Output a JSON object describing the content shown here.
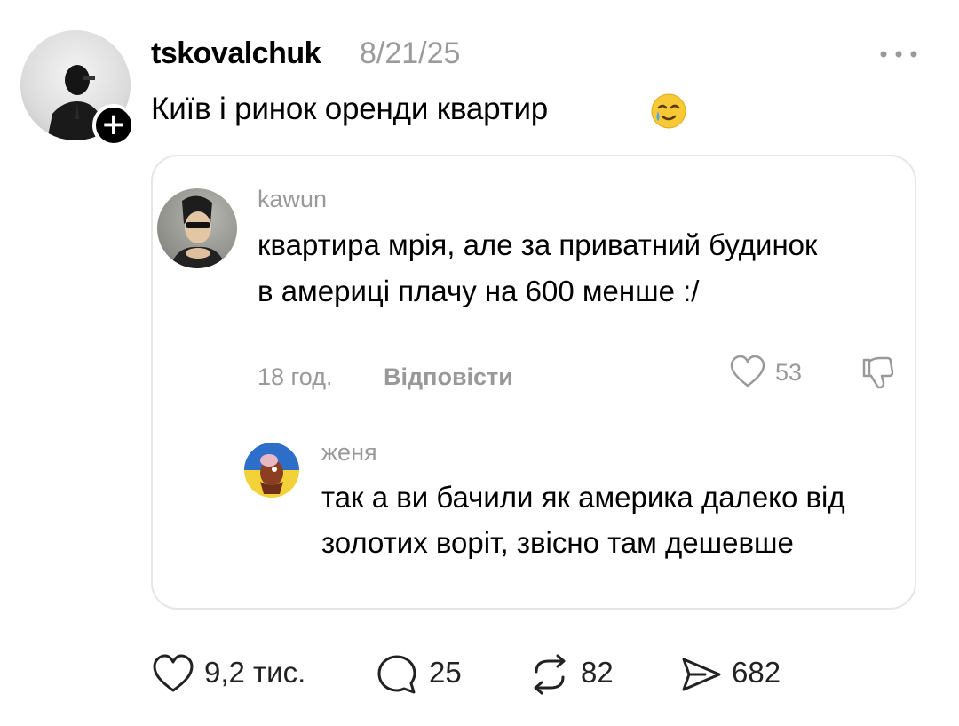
{
  "post": {
    "username": "tskovalchuk",
    "date": "8/21/25",
    "text": "Київ і ринок оренди квартир",
    "follow_symbol": "+",
    "more_icon": "more-horizontal-icon",
    "emoji_icon": "smiling-face-with-tear-icon"
  },
  "quoted_comment": {
    "author": "kawun",
    "text": "квартира мрія, але за приватний будинок в америці плачу на 600 менше :/",
    "time": "18 год.",
    "reply_label": "Відповісти",
    "likes": "53",
    "reply": {
      "author": "женя",
      "text": "так а ви бачили як америка далеко від золотих воріт, звісно там дешевше"
    }
  },
  "actions": {
    "likes": "9,2 тис.",
    "comments": "25",
    "reposts": "82",
    "shares": "682"
  },
  "colors": {
    "text": "#000000",
    "secondary": "#999999",
    "card_border": "#e6e6e6"
  }
}
